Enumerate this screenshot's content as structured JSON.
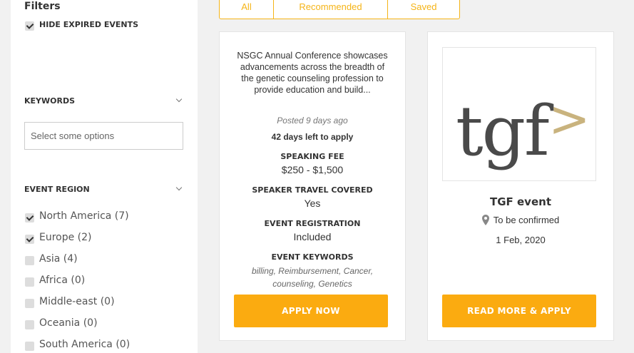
{
  "sidebar": {
    "filters_title": "Filters",
    "hide_expired_label": "HIDE EXPIRED EVENTS",
    "keywords": {
      "label": "KEYWORDS",
      "placeholder": "Select some options"
    },
    "region": {
      "label": "EVENT REGION",
      "items": [
        {
          "label": "North America (7)",
          "checked": true
        },
        {
          "label": "Europe (2)",
          "checked": true
        },
        {
          "label": "Asia (4)",
          "checked": false
        },
        {
          "label": "Africa (0)",
          "checked": false
        },
        {
          "label": "Middle-east (0)",
          "checked": false
        },
        {
          "label": "Oceania (0)",
          "checked": false
        },
        {
          "label": "South America (0)",
          "checked": false
        }
      ]
    }
  },
  "tabs": [
    "All",
    "Recommended",
    "Saved"
  ],
  "cards": [
    {
      "description": "NSGC Annual Conference showcases advancements across the breadth of the genetic counseling profession to provide education and build...",
      "posted": "Posted 9 days ago",
      "days_left": "42 days left to apply",
      "speaking_fee_label": "SPEAKING FEE",
      "speaking_fee": "$250 - $1,500",
      "travel_label": "SPEAKER TRAVEL COVERED",
      "travel": "Yes",
      "registration_label": "EVENT REGISTRATION",
      "registration": "Included",
      "keywords_label": "EVENT KEYWORDS",
      "keywords": "billing, Reimbursement, Cancer, counseling, Genetics",
      "button": "APPLY NOW"
    },
    {
      "logo_text": "tgf>",
      "title": "TGF event",
      "location": "To be confirmed",
      "date": "1 Feb, 2020",
      "button": "READ MORE & APPLY"
    }
  ],
  "colors": {
    "accent": "#fbab10",
    "tab_accent": "#f5b417",
    "logo_dark": "#4a4a4a",
    "logo_tan": "#c9b37e"
  },
  "icons": {
    "location": "map-pin-icon",
    "checkbox_checked": "checkmark-icon",
    "section_toggle": "chevron-down-icon"
  }
}
